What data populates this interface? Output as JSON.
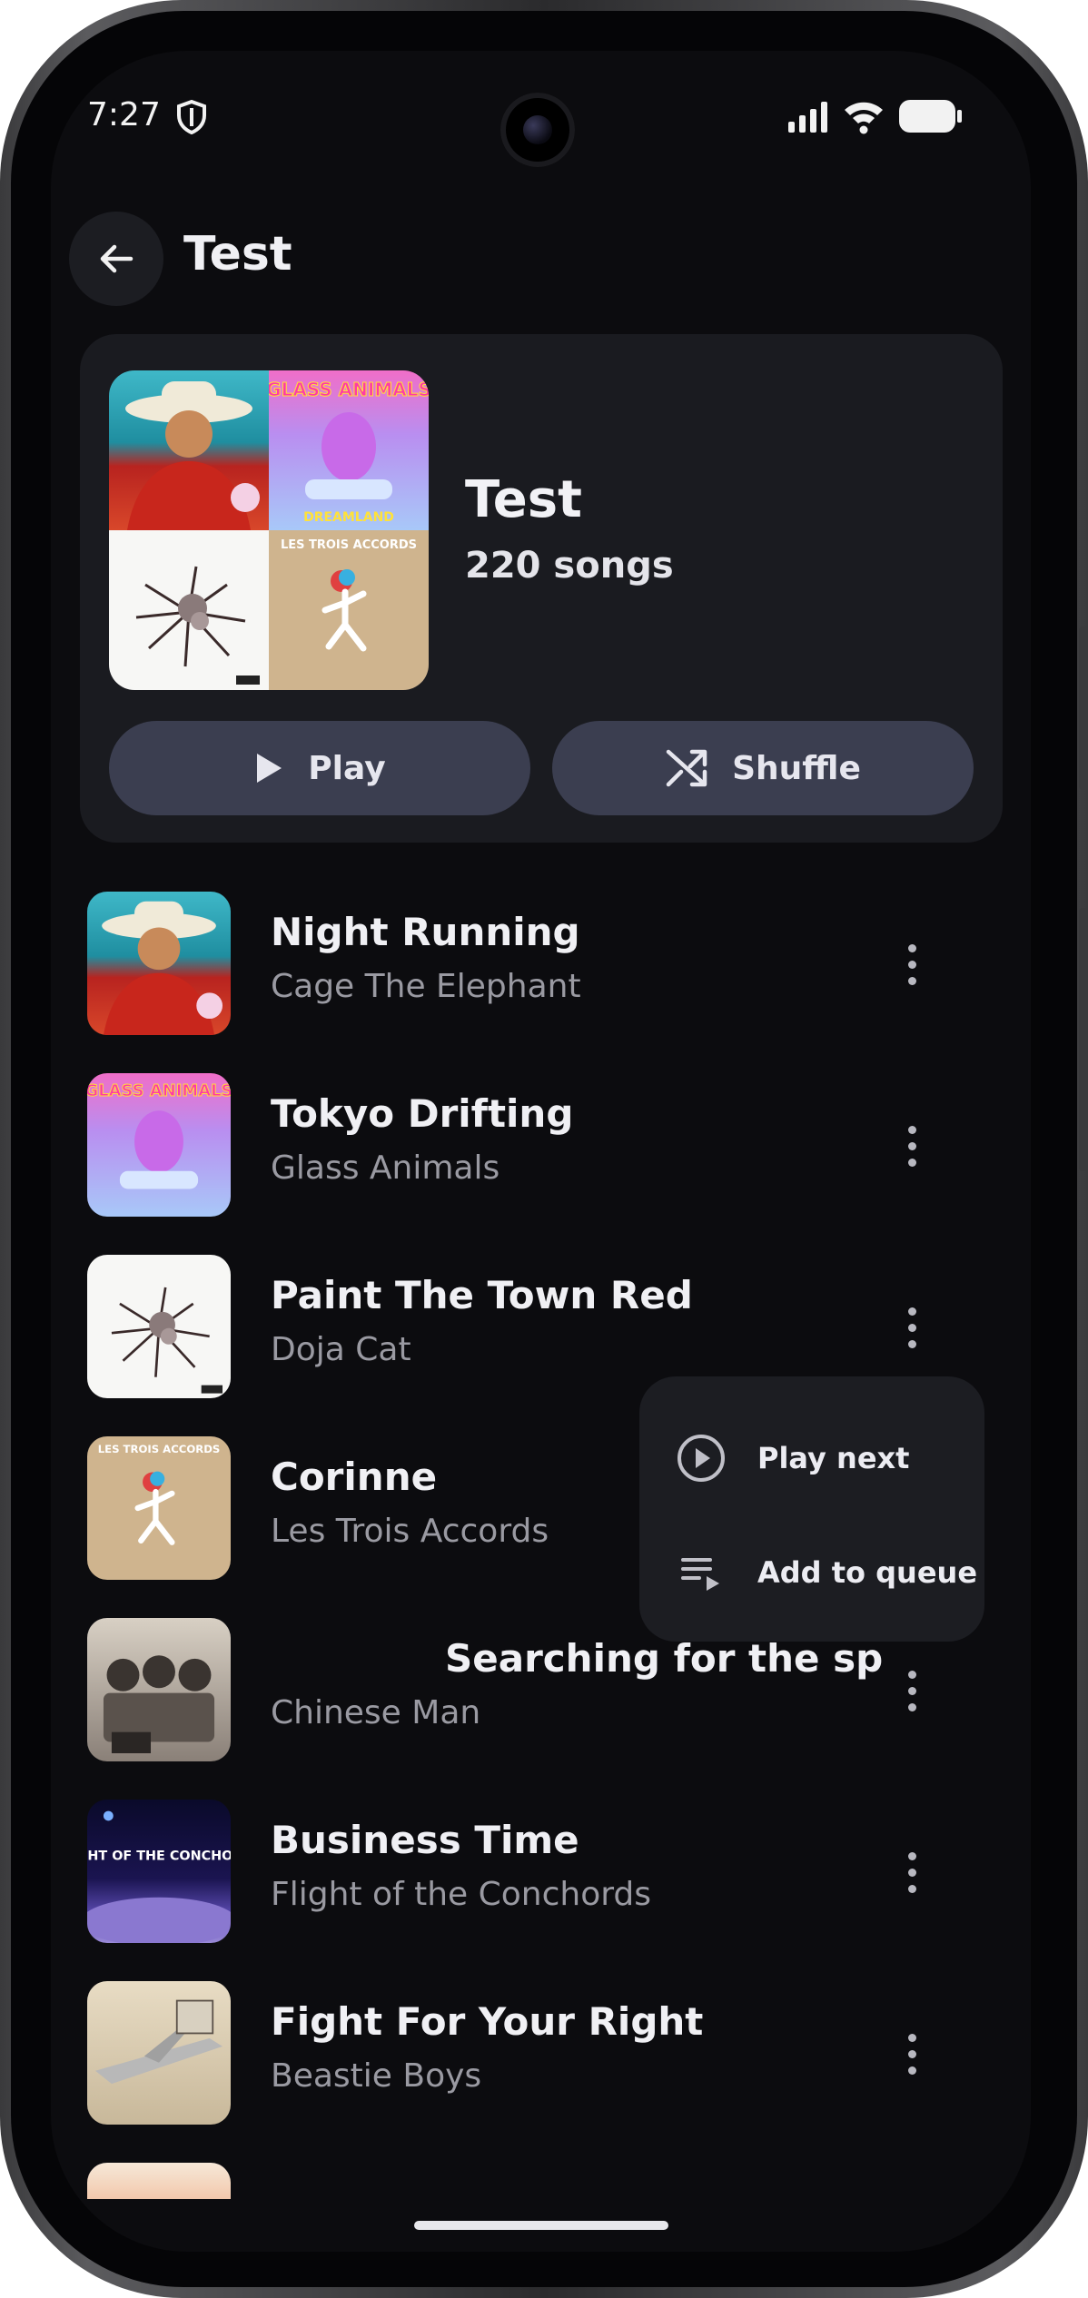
{
  "status_bar": {
    "time": "7:27"
  },
  "header": {
    "title": "Test"
  },
  "playlist": {
    "title": "Test",
    "subtitle": "220 songs",
    "play_label": "Play",
    "shuffle_label": "Shuffle"
  },
  "songs": [
    {
      "title": "Night Running",
      "artist": "Cage The Elephant",
      "art_label": ""
    },
    {
      "title": "Tokyo Drifting",
      "artist": "Glass Animals",
      "art_label": "GLASS ANIMALS"
    },
    {
      "title": "Paint The Town Red",
      "artist": "Doja Cat",
      "art_label": ""
    },
    {
      "title": "Corinne",
      "artist": "Les Trois Accords",
      "art_label": "LES TROIS ACCORDS"
    },
    {
      "title": "Searching for the spa",
      "artist": "Chinese Man",
      "art_label": ""
    },
    {
      "title": "Business Time",
      "artist": "Flight of the Conchords",
      "art_label": "FLIGHT OF THE CONCHORDS"
    },
    {
      "title": "Fight For Your Right",
      "artist": "Beastie Boys",
      "art_label": ""
    }
  ],
  "menu": {
    "play_next": "Play next",
    "add_to_queue": "Add to queue"
  }
}
